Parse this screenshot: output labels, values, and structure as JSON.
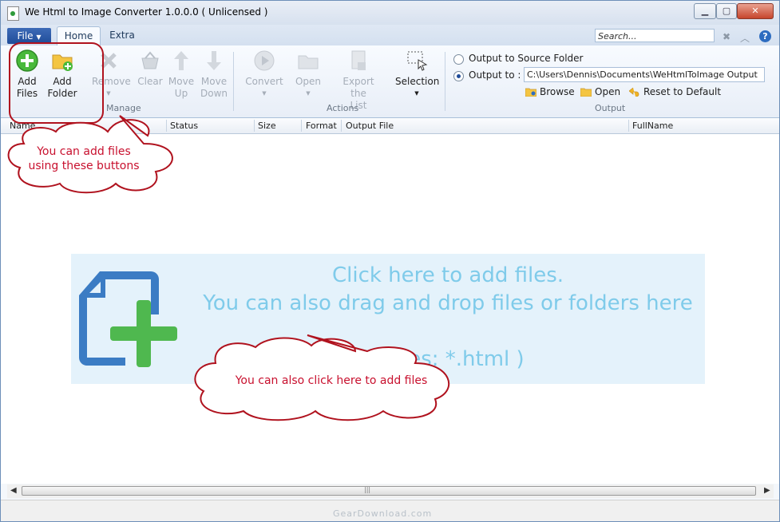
{
  "window": {
    "title": "We Html to Image Converter 1.0.0.0  ( Unlicensed )"
  },
  "menubar": {
    "file_label": "File",
    "tabs": [
      {
        "label": "Home"
      },
      {
        "label": "Extra"
      }
    ],
    "search_placeholder": "Search..."
  },
  "ribbon": {
    "manage": {
      "label": "Manage",
      "buttons": [
        {
          "label1": "Add",
          "label2": "Files"
        },
        {
          "label1": "Add",
          "label2": "Folder"
        },
        {
          "label1": "Remove",
          "label2": ""
        },
        {
          "label1": "Clear",
          "label2": ""
        },
        {
          "label1": "Move",
          "label2": "Up"
        },
        {
          "label1": "Move",
          "label2": "Down"
        }
      ]
    },
    "actions": {
      "label": "Actions",
      "buttons": [
        {
          "label1": "Convert",
          "label2": ""
        },
        {
          "label1": "Open",
          "label2": ""
        },
        {
          "label1": "Export the",
          "label2": "List"
        },
        {
          "label1": "Selection",
          "label2": ""
        }
      ]
    },
    "output": {
      "label": "Output",
      "source_option": "Output to Source Folder",
      "output_to_label": "Output to :",
      "output_path": "C:\\Users\\Dennis\\Documents\\WeHtmlToImage Output",
      "browse": "Browse",
      "open": "Open",
      "reset": "Reset to Default"
    }
  },
  "columns": [
    "Name",
    "Status",
    "Size",
    "Format",
    "Output File",
    "FullName"
  ],
  "dropzone": {
    "line1": "Click here to add files.",
    "line2": "You can also drag and drop files or folders here",
    "line3": "( Files: *.html )"
  },
  "callouts": {
    "top": "You can add files using these buttons",
    "bottom": "You can also click here to add files"
  },
  "watermark": "GearDownload.com"
}
